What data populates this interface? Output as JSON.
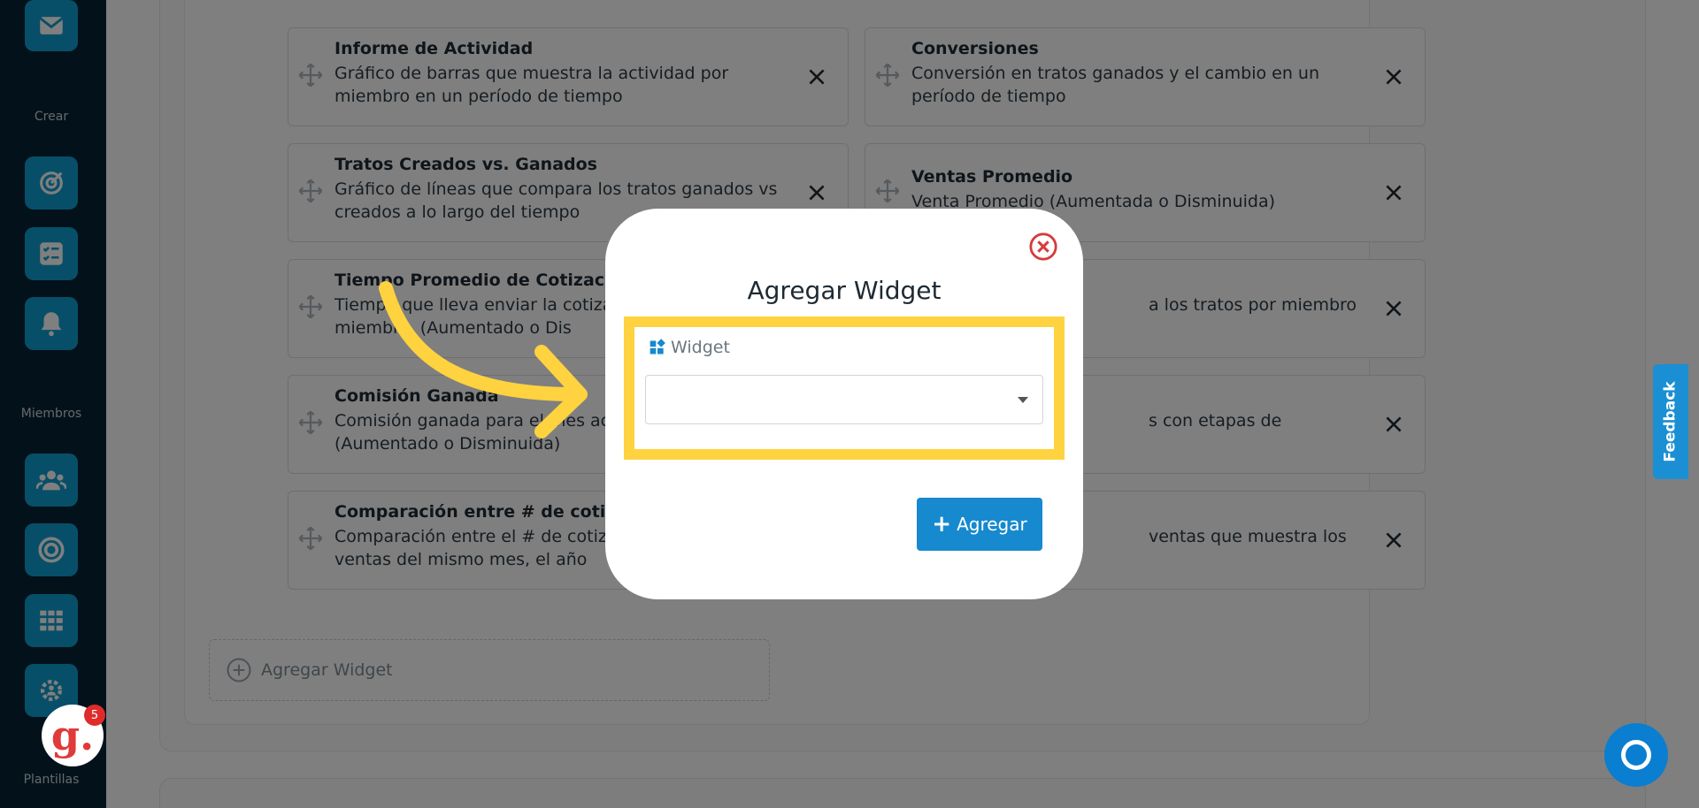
{
  "sidebar": {
    "section_create": "Crear",
    "section_members": "Miembros",
    "section_templates": "Plantillas",
    "badge_count": "5",
    "logo_text": "g."
  },
  "widgets": [
    {
      "title": "Informe de Actividad",
      "desc": "Gráfico de barras que muestra la actividad por miembro en un período de tiempo"
    },
    {
      "title": "Conversiones",
      "desc": "Conversión en tratos ganados y el cambio en un período de tiempo"
    },
    {
      "title": "Tratos Creados vs. Ganados",
      "desc": "Gráfico de líneas que compara los tratos ganados vs creados a lo largo del tiempo"
    },
    {
      "title": "Ventas Promedio",
      "desc": "Venta Promedio (Aumentada o Disminuida)"
    },
    {
      "title": "Tiempo Promedio de Cotización",
      "desc": "Tiempo que lleva enviar la cotización des asignada al miembro. (Aumentado o Dis"
    },
    {
      "title": "",
      "desc": "a los tratos por miembro"
    },
    {
      "title": "Comisión Ganada",
      "desc": "Comisión ganada para el mes actual y e pasado (Aumentado o Disminuida)"
    },
    {
      "title": "",
      "desc": "s con etapas de"
    },
    {
      "title": "Comparación entre # de cotizaciones y -",
      "desc": "Comparación entre el # de cotizaciones pedidos de ventas del mismo mes, el año"
    },
    {
      "title": "",
      "desc": "ventas que muestra los"
    }
  ],
  "add_widget_label": "Agregar Widget",
  "feedback_label": "Feedback",
  "modal": {
    "title": "Agregar Widget",
    "field_label": "Widget",
    "select_value": "",
    "add_button": "Agregar",
    "add_button_plus": "+"
  },
  "colors": {
    "sidebar_bg": "#062535",
    "accent": "#0f9fd0",
    "highlight": "#ffd23f",
    "close_red": "#d63b3b"
  }
}
